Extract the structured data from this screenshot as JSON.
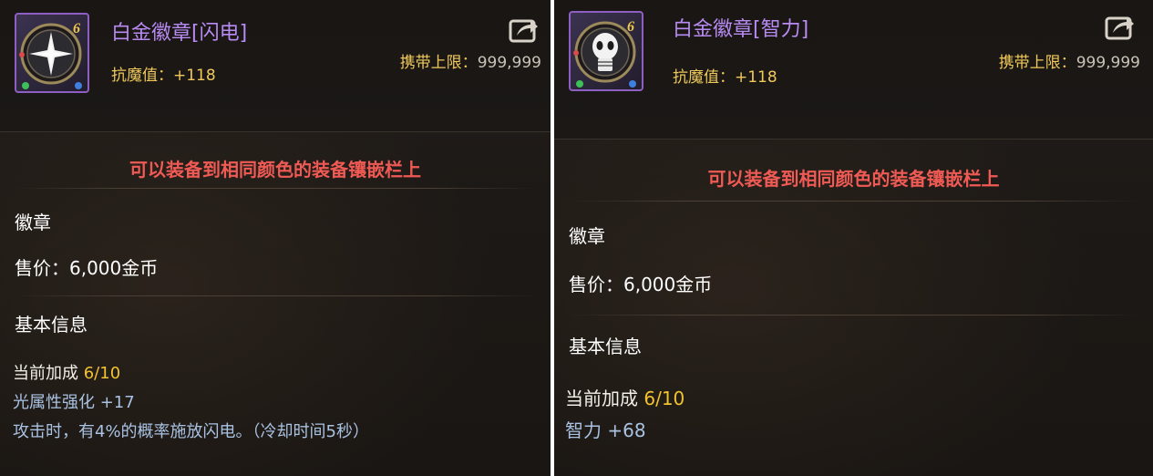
{
  "cards": [
    {
      "name": "白金徽章[闪电]",
      "level_badge": "6",
      "icon": "lightning-star-icon",
      "stat": "抗魔值：+118",
      "carry_label": "携带上限：",
      "carry_value": "999,999",
      "share_icon": "share-icon",
      "notice": "可以装备到相同颜色的装备镶嵌栏上",
      "category": "徽章",
      "price": "售价：6,000金币",
      "section_title": "基本信息",
      "bonus_label": "当前加成",
      "bonus_value": "6/10",
      "attr_line": "光属性强化 +17",
      "effect_line": "攻击时，有4%的概率施放闪电。（冷却时间5秒）"
    },
    {
      "name": "白金徽章[智力]",
      "level_badge": "6",
      "icon": "lightbulb-skull-icon",
      "stat": "抗魔值：+118",
      "carry_label": "携带上限：",
      "carry_value": "999,999",
      "share_icon": "share-icon",
      "notice": "可以装备到相同颜色的装备镶嵌栏上",
      "category": "徽章",
      "price": "售价：6,000金币",
      "section_title": "基本信息",
      "bonus_label": "当前加成",
      "bonus_value": "6/10",
      "attr_line": "智力 +68"
    }
  ],
  "colors": {
    "item_name": "#b88bf2",
    "stat": "#f0c95a",
    "notice": "#f05a55",
    "bonus_value": "#f2c230",
    "attribute": "#a9c2e2"
  }
}
